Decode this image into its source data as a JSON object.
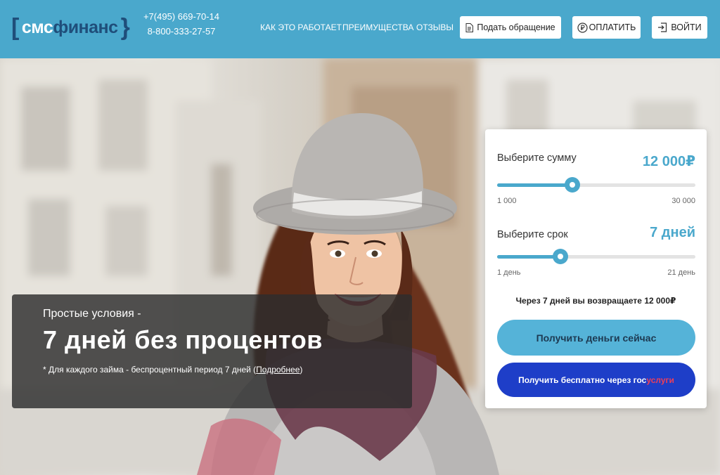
{
  "header": {
    "logo": {
      "sms": "смс",
      "fin": "финанс"
    },
    "phones": [
      "+7(495) 669-70-14",
      "8-800-333-27-57"
    ],
    "nav": [
      "КАК ЭТО РАБОТАЕТ",
      "ПРЕИМУЩЕСТВА",
      "ОТЗЫВЫ"
    ],
    "buttons": {
      "appeal": "Подать обращение",
      "pay": "ОПЛАТИТЬ",
      "login": "ВОЙТИ"
    },
    "accent": "#4aa8cc"
  },
  "promo": {
    "subtitle": "Простые условия -",
    "title": "7 дней без процентов",
    "note": "* Для каждого займа - беспроцентный период 7 дней (",
    "note_link": "Подробнее",
    "note_end": ")"
  },
  "calculator": {
    "amount": {
      "label": "Выберите сумму",
      "value": "12 000₽",
      "min": "1 000",
      "max": "30 000",
      "level": 0.38
    },
    "term": {
      "label": "Выберите срок",
      "value": "7 дней",
      "min": "1 день",
      "max": "21 день",
      "level": 0.32
    },
    "summary": "Через 7 дней вы возвращаете 12 000₽",
    "primary_button": "Получить деньги сейчас",
    "gos_button": {
      "prefix": "Получить бесплатно через гос",
      "suffix": "услуги"
    }
  }
}
